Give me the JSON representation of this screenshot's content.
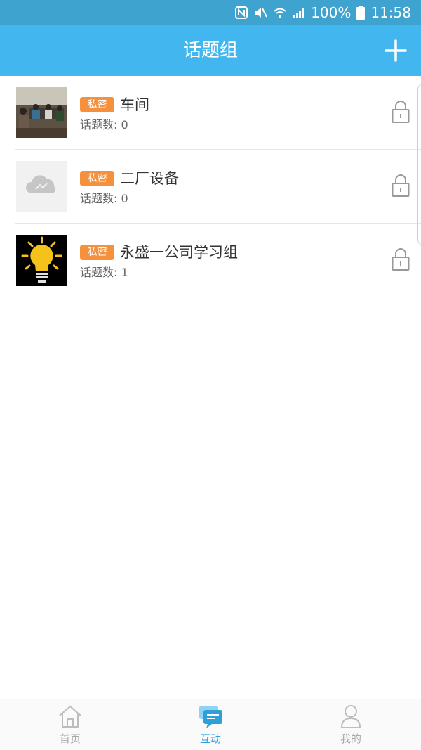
{
  "status_bar": {
    "battery": "100%",
    "time": "11:58"
  },
  "header": {
    "title": "话题组",
    "add_icon": "plus-icon"
  },
  "groups": [
    {
      "badge": "私密",
      "name": "车间",
      "count_label": "话题数: 0",
      "thumb": "meeting-photo",
      "lock_icon": "lock-icon"
    },
    {
      "badge": "私密",
      "name": "二厂设备",
      "count_label": "话题数: 0",
      "thumb": "cloud-placeholder",
      "lock_icon": "lock-icon"
    },
    {
      "badge": "私密",
      "name": "永盛一公司学习组",
      "count_label": "话题数: 1",
      "thumb": "lightbulb-image",
      "lock_icon": "lock-icon"
    }
  ],
  "bottom_nav": {
    "items": [
      {
        "label": "首页",
        "icon": "home-icon",
        "active": false
      },
      {
        "label": "互动",
        "icon": "chat-icon",
        "active": true
      },
      {
        "label": "我的",
        "icon": "user-icon",
        "active": false
      }
    ]
  },
  "colors": {
    "status_bar": "#3ea3cf",
    "header": "#42b6ee",
    "badge": "#f5903d",
    "nav_active": "#2f9fd8",
    "nav_inactive": "#a8a8a8"
  }
}
